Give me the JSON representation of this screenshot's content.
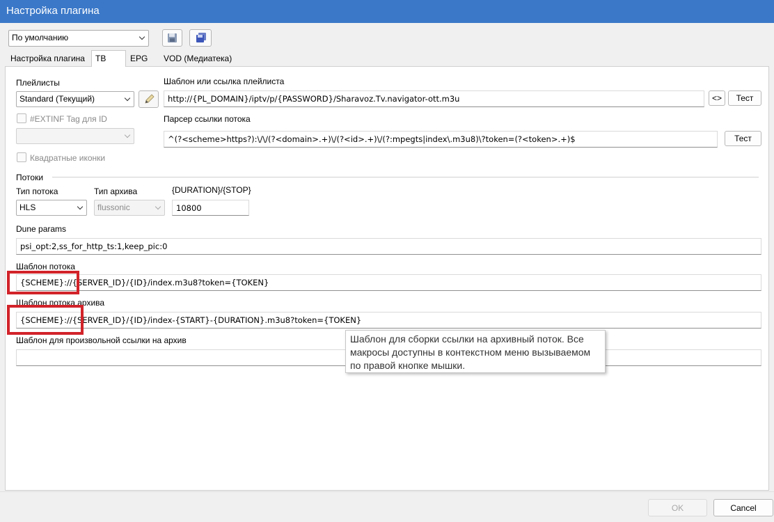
{
  "window": {
    "title": "Настройка плагина"
  },
  "toolbar": {
    "preset": "По умолчанию",
    "save_icon": "floppy-disk-icon",
    "save_all_icon": "multiple-floppy-icon"
  },
  "tabs": [
    {
      "label": "Настройка плагина",
      "active": false
    },
    {
      "label": "ТВ",
      "active": true
    },
    {
      "label": "EPG",
      "active": false
    },
    {
      "label": "VOD (Медиатека)",
      "active": false
    }
  ],
  "playlists": {
    "label": "Плейлисты",
    "selected": "Standard (Текущий)",
    "edit_icon": "pencil-icon",
    "extinf_label": "#EXTINF Tag для ID",
    "extinf_selected": "",
    "square_icons_label": "Квадратные иконки"
  },
  "playlist_template": {
    "label": "Шаблон или ссылка плейлиста",
    "value": "http://{PL_DOMAIN}/iptv/p/{PASSWORD}/Sharavoz.Tv.navigator-ott.m3u",
    "code_button": "<>",
    "test_button": "Тест"
  },
  "parser": {
    "label": "Парсер ссылки потока",
    "value": "^(?<scheme>https?):\\/\\/(?<domain>.+)\\/(?<id>.+)\\/(?:mpegts|index\\.m3u8)\\?token=(?<token>.+)$",
    "test_button": "Тест"
  },
  "streams": {
    "section_label": "Потоки",
    "stream_type_label": "Тип потока",
    "stream_type": "HLS",
    "archive_type_label": "Тип архива",
    "archive_type": "flussonic",
    "duration_label": "{DURATION}/{STOP}",
    "duration_value": "10800"
  },
  "dune": {
    "label": "Dune params",
    "value": "psi_opt:2,ss_for_http_ts:1,keep_pic:0"
  },
  "stream_template": {
    "label": "Шаблон потока",
    "value": "{SCHEME}://{SERVER_ID}/{ID}/index.m3u8?token={TOKEN}"
  },
  "archive_template": {
    "label": "Шаблон потока архива",
    "value": "{SCHEME}://{SERVER_ID}/{ID}/index-{START}-{DURATION}.m3u8?token={TOKEN}"
  },
  "custom_archive": {
    "label": "Шаблон для произвольной ссылки на архив",
    "value": ""
  },
  "tooltip": {
    "text": "Шаблон для сборки ссылки на архивный поток. Все макросы доступны в контекстном меню вызываемом по правой кнопке мышки."
  },
  "footer": {
    "ok": "OK",
    "cancel": "Cancel"
  },
  "colors": {
    "titlebar": "#3b78c8",
    "highlight": "#d2232a"
  }
}
